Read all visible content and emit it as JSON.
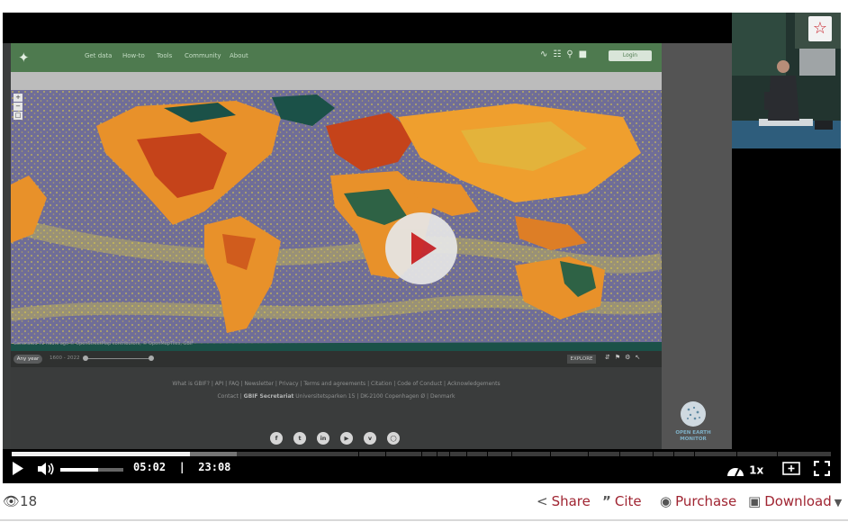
{
  "slide": {
    "nav": [
      "Get data",
      "How-to",
      "Tools",
      "Community",
      "About"
    ],
    "login": "Login",
    "attribution": "Generated 72 hours ago © OpenStreetMap contributors, © OpenMapTiles, GBIF",
    "any_year": "Any year",
    "year_range": "1600 - 2022",
    "explore": "EXPLORE",
    "footer_line1": "What is GBIF? | API | FAQ | Newsletter | Privacy | Terms and agreements | Citation | Code of Conduct | Acknowledgements",
    "footer_line2_prefix": "Contact | ",
    "footer_line2_bold": "GBIF Secretariat",
    "footer_line2_rest": " Universitetsparken 15 | DK-2100 Copenhagen Ø | Denmark",
    "social_icons": [
      "facebook-icon",
      "twitter-icon",
      "linkedin-icon",
      "youtube-icon",
      "vimeo-icon",
      "instagram-icon"
    ],
    "badge_line1": "OPEN EARTH",
    "badge_line2": "MONITOR"
  },
  "player": {
    "current_time": "05:02",
    "separator": "|",
    "duration": "23:08",
    "progress_fraction": 0.218,
    "buffered_fraction": 0.275,
    "volume_fraction": 0.6,
    "speed": "1x",
    "accent_color": "#c9252d"
  },
  "below": {
    "views": "18",
    "share": "Share",
    "cite": "Cite",
    "purchase": "Purchase",
    "download": "Download"
  }
}
